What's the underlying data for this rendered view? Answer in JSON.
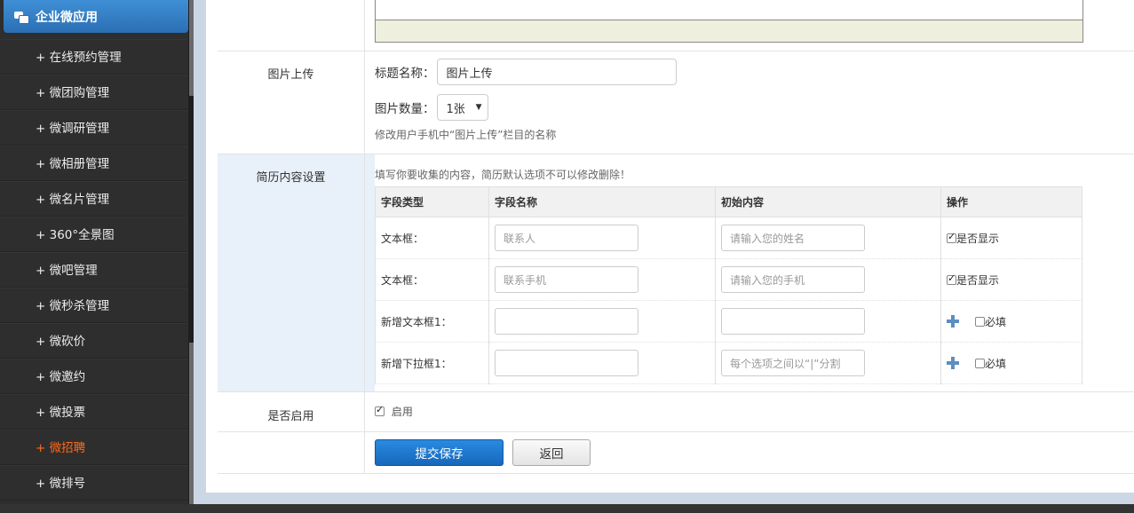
{
  "sidebar": {
    "header": "企业微应用",
    "items": [
      {
        "label": "+ 在线预约管理"
      },
      {
        "label": "+ 微团购管理"
      },
      {
        "label": "+ 微调研管理"
      },
      {
        "label": "+ 微相册管理"
      },
      {
        "label": "+ 微名片管理"
      },
      {
        "label": "+ 360°全景图"
      },
      {
        "label": "+ 微吧管理"
      },
      {
        "label": "+ 微秒杀管理"
      },
      {
        "label": "+ 微砍价"
      },
      {
        "label": "+ 微邀约"
      },
      {
        "label": "+ 微投票"
      },
      {
        "label": "+ 微招聘"
      },
      {
        "label": "+ 微排号"
      }
    ],
    "active_color": "#ff6a1a"
  },
  "image_upload": {
    "label": "图片上传",
    "title_label": "标题名称：",
    "title_value": "图片上传",
    "count_label": "图片数量：",
    "count_value": "1张",
    "hint": "修改用户手机中“图片上传”栏目的名称"
  },
  "resume": {
    "label": "简历内容设置",
    "hint": "填写你要收集的内容，简历默认选项不可以修改删除！",
    "columns": [
      "字段类型",
      "字段名称",
      "初始内容",
      "操作"
    ],
    "rows": [
      {
        "type": "文本框：",
        "name_placeholder": "联系人",
        "init_placeholder": "请输入您的姓名",
        "op_label": "是否显示",
        "checked": true
      },
      {
        "type": "文本框：",
        "name_placeholder": "联系手机",
        "init_placeholder": "请输入您的手机",
        "op_label": "是否显示",
        "checked": true
      },
      {
        "type": "新增文本框1：",
        "name_placeholder": "",
        "init_placeholder": "",
        "op_label": "必填",
        "checked": false
      },
      {
        "type": "新增下拉框1：",
        "name_placeholder": "",
        "init_placeholder": "每个选项之间以“|”分割",
        "op_label": "必填",
        "checked": false
      }
    ]
  },
  "enable": {
    "label": "是否启用",
    "checkbox_label": "启用",
    "checked": true
  },
  "actions": {
    "submit": "提交保存",
    "back": "返回"
  },
  "colors": {
    "primary": "#1a73c8",
    "sidebar_bg": "#2e2e2e",
    "highlight_row": "#e8f0fa"
  }
}
